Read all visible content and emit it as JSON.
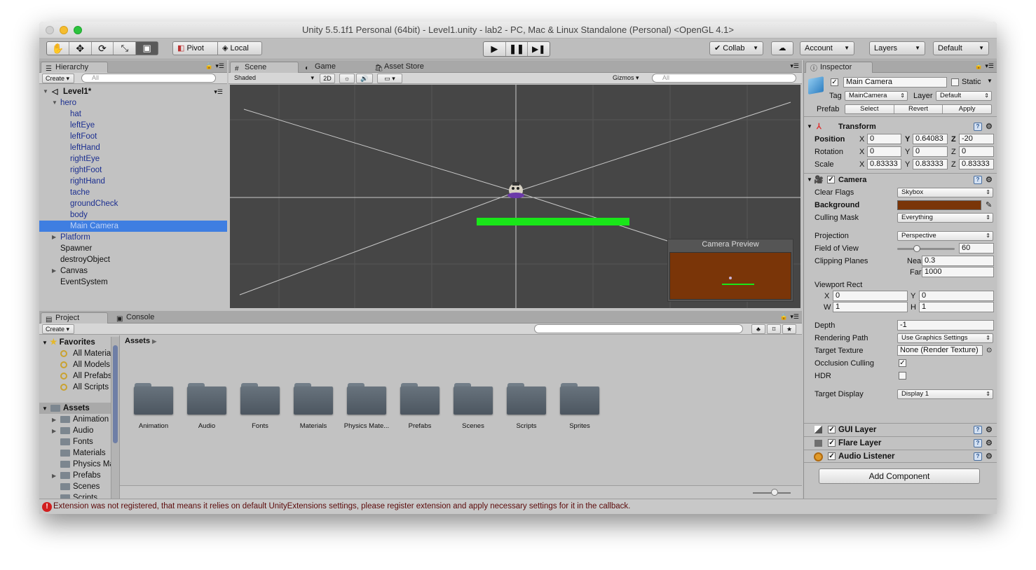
{
  "window": {
    "title": "Unity 5.5.1f1 Personal (64bit) - Level1.unity - lab2 - PC, Mac & Linux Standalone (Personal) <OpenGL 4.1>"
  },
  "toolbar": {
    "pivot_label": "Pivot",
    "local_label": "Local",
    "collab_label": "Collab",
    "account_label": "Account",
    "layers_label": "Layers",
    "layout_label": "Default"
  },
  "hierarchy": {
    "tab_label": "Hierarchy",
    "create_label": "Create",
    "search_placeholder": "All",
    "scene_name": "Level1*",
    "items": [
      {
        "label": "hero"
      },
      {
        "label": "hat"
      },
      {
        "label": "leftEye"
      },
      {
        "label": "leftFoot"
      },
      {
        "label": "leftHand"
      },
      {
        "label": "rightEye"
      },
      {
        "label": "rightFoot"
      },
      {
        "label": "rightHand"
      },
      {
        "label": "tache"
      },
      {
        "label": "groundCheck"
      },
      {
        "label": "body"
      },
      {
        "label": "Main Camera"
      },
      {
        "label": "Platform"
      },
      {
        "label": "Spawner"
      },
      {
        "label": "destroyObject"
      },
      {
        "label": "Canvas"
      },
      {
        "label": "EventSystem"
      }
    ]
  },
  "scene": {
    "tabs": [
      {
        "label": "Scene"
      },
      {
        "label": "Game"
      },
      {
        "label": "Asset Store"
      }
    ],
    "shading_mode": "Shaded",
    "mode_2d_label": "2D",
    "gizmos_label": "Gizmos",
    "search_placeholder": "All",
    "camera_preview_title": "Camera Preview",
    "background_color": "#464646",
    "platform_color": "#19e619"
  },
  "project": {
    "tabs": [
      {
        "label": "Project"
      },
      {
        "label": "Console"
      }
    ],
    "create_label": "Create",
    "favorites_label": "Favorites",
    "favorites": [
      {
        "label": "All Materials"
      },
      {
        "label": "All Models"
      },
      {
        "label": "All Prefabs"
      },
      {
        "label": "All Scripts"
      }
    ],
    "assets_label": "Assets",
    "asset_tree": [
      {
        "label": "Animation"
      },
      {
        "label": "Audio"
      },
      {
        "label": "Fonts"
      },
      {
        "label": "Materials"
      },
      {
        "label": "Physics Materials"
      },
      {
        "label": "Prefabs"
      },
      {
        "label": "Scenes"
      },
      {
        "label": "Scripts"
      }
    ],
    "breadcrumb": "Assets",
    "folders": [
      {
        "label": "Animation"
      },
      {
        "label": "Audio"
      },
      {
        "label": "Fonts"
      },
      {
        "label": "Materials"
      },
      {
        "label": "Physics Mate..."
      },
      {
        "label": "Prefabs"
      },
      {
        "label": "Scenes"
      },
      {
        "label": "Scripts"
      },
      {
        "label": "Sprites"
      }
    ]
  },
  "inspector": {
    "tab_label": "Inspector",
    "object_name": "Main Camera",
    "static_label": "Static",
    "tag_label": "Tag",
    "tag_value": "MainCamera",
    "layer_label": "Layer",
    "layer_value": "Default",
    "prefab_label": "Prefab",
    "prefab_buttons": {
      "select": "Select",
      "revert": "Revert",
      "apply": "Apply"
    },
    "transform": {
      "title": "Transform",
      "position_label": "Position",
      "rotation_label": "Rotation",
      "scale_label": "Scale",
      "axes": {
        "x": "X",
        "y": "Y",
        "z": "Z"
      },
      "position": {
        "x": "0",
        "y": "0.64083",
        "z": "-20"
      },
      "rotation": {
        "x": "0",
        "y": "0",
        "z": "0"
      },
      "scale": {
        "x": "0.83333",
        "y": "0.83333",
        "z": "0.83333"
      }
    },
    "camera": {
      "title": "Camera",
      "clear_flags_label": "Clear Flags",
      "clear_flags_value": "Skybox",
      "background_label": "Background",
      "background_color": "#7a3508",
      "culling_mask_label": "Culling Mask",
      "culling_mask_value": "Everything",
      "projection_label": "Projection",
      "projection_value": "Perspective",
      "fov_label": "Field of View",
      "fov_value": "60",
      "clipping_label": "Clipping Planes",
      "near_label": "Near",
      "near_value": "0.3",
      "far_label": "Far",
      "far_value": "1000",
      "viewport_label": "Viewport Rect",
      "viewport": {
        "x": "0",
        "y": "0",
        "w": "1",
        "h": "1"
      },
      "viewport_axes": {
        "x": "X",
        "y": "Y",
        "w": "W",
        "h": "H"
      },
      "depth_label": "Depth",
      "depth_value": "-1",
      "rendering_path_label": "Rendering Path",
      "rendering_path_value": "Use Graphics Settings",
      "target_texture_label": "Target Texture",
      "target_texture_value": "None (Render Texture)",
      "occlusion_label": "Occlusion Culling",
      "hdr_label": "HDR",
      "target_display_label": "Target Display",
      "target_display_value": "Display 1"
    },
    "components": [
      {
        "label": "GUI Layer"
      },
      {
        "label": "Flare Layer"
      },
      {
        "label": "Audio Listener"
      }
    ],
    "add_component_label": "Add Component"
  },
  "status": {
    "message": "Extension  was not registered, that means it relies on default UnityExtensions settings, please register extension and apply necessary settings for it in the callback."
  }
}
